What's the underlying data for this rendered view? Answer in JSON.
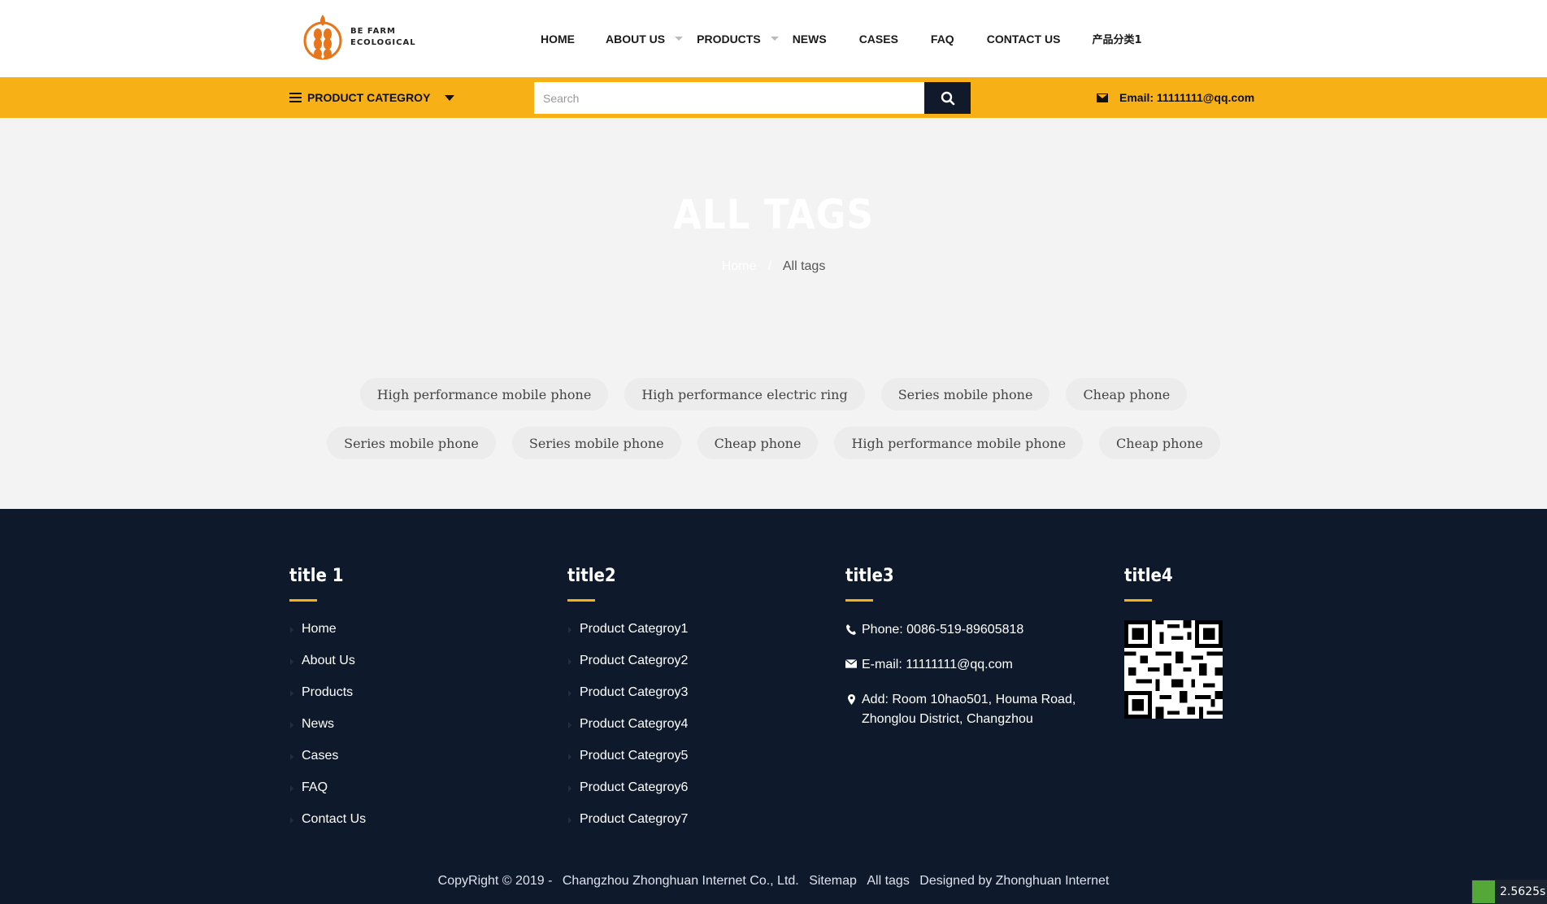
{
  "header": {
    "logo_line1": "BE FARM",
    "logo_line2": "ECOLOGICAL",
    "nav": [
      {
        "label": "HOME",
        "has_caret": false
      },
      {
        "label": "ABOUT US",
        "has_caret": true
      },
      {
        "label": "PRODUCTS",
        "has_caret": true
      },
      {
        "label": "NEWS",
        "has_caret": false
      },
      {
        "label": "CASES",
        "has_caret": false
      },
      {
        "label": "FAQ",
        "has_caret": false
      },
      {
        "label": "CONTACT US",
        "has_caret": false
      },
      {
        "label": "产品分类1",
        "has_caret": false
      }
    ]
  },
  "bar": {
    "category_label": "PRODUCT CATEGROY",
    "search_placeholder": "Search",
    "email": "Email: 11111111@qq.com"
  },
  "banner": {
    "title": "ALL TAGS",
    "crumb_home": "Home",
    "crumb_current": "All tags"
  },
  "tags": {
    "row1": [
      "High performance mobile phone",
      "High performance electric ring",
      "Series mobile phone",
      "Cheap phone"
    ],
    "row2": [
      "Series mobile phone",
      "Series mobile phone",
      "Cheap phone",
      "High performance mobile phone",
      "Cheap phone"
    ]
  },
  "footer": {
    "col1": {
      "title": "title 1",
      "items": [
        "Home",
        "About Us",
        "Products",
        "News",
        "Cases",
        "FAQ",
        "Contact Us"
      ]
    },
    "col2": {
      "title": "title2",
      "items": [
        "Product Categroy1",
        "Product Categroy2",
        "Product Categroy3",
        "Product Categroy4",
        "Product Categroy5",
        "Product Categroy6",
        "Product Categroy7"
      ]
    },
    "col3": {
      "title": "title3",
      "phone": "Phone: 0086-519-89605818",
      "email": "E-mail: 11111111@qq.com",
      "address": "Add: Room 10hao501, Houma Road, Zhonglou District, Changzhou"
    },
    "col4": {
      "title": "title4"
    },
    "copyright": "CopyRight © 2019 -",
    "company": "Changzhou Zhonghuan Internet Co., Ltd.",
    "sitemap": "Sitemap",
    "all_tags": "All tags",
    "designed": "Designed by Zhonghuan Internet"
  },
  "perf_badge": "2.5625s",
  "colors": {
    "accent": "#f8b017",
    "footer_bg": "#0e1a2b",
    "page_bg": "#f3f3f3"
  }
}
